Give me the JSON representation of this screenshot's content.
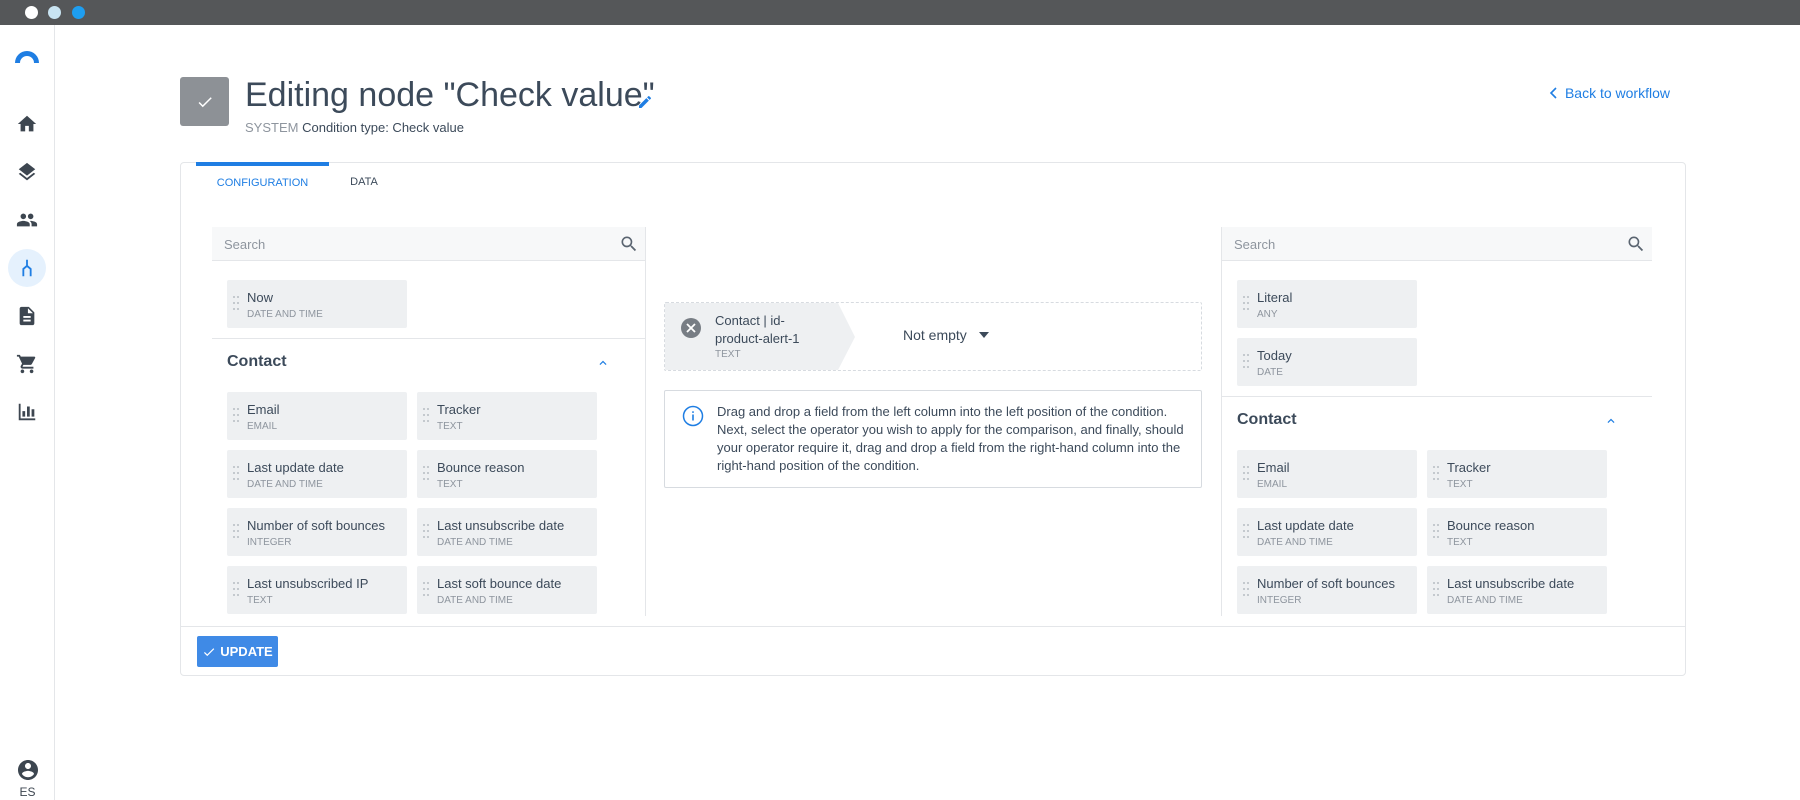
{
  "window": {
    "controls": [
      "close",
      "minimize",
      "maximize"
    ]
  },
  "sidebar": {
    "logo": "arc-logo-icon",
    "items": [
      {
        "icon": "home-icon",
        "active": false
      },
      {
        "icon": "layers-icon",
        "active": false
      },
      {
        "icon": "people-icon",
        "active": false
      },
      {
        "icon": "workflow-icon",
        "active": true
      },
      {
        "icon": "document-icon",
        "active": false
      },
      {
        "icon": "cart-icon",
        "active": false
      },
      {
        "icon": "bar-chart-icon",
        "active": false
      }
    ],
    "user_lang": "ES"
  },
  "header": {
    "title": "Editing node \"Check value\"",
    "system_label": "SYSTEM",
    "condition_type": "Condition type: Check value",
    "back_link": "Back to workflow"
  },
  "tabs": [
    {
      "label": "CONFIGURATION",
      "active": true
    },
    {
      "label": "DATA",
      "active": false
    }
  ],
  "left_panel": {
    "search_placeholder": "Search",
    "top_fields": [
      {
        "name": "Now",
        "type": "DATE AND TIME"
      }
    ],
    "group_title": "Contact",
    "fields": [
      {
        "name": "Email",
        "type": "EMAIL"
      },
      {
        "name": "Tracker",
        "type": "TEXT"
      },
      {
        "name": "Last update date",
        "type": "DATE AND TIME"
      },
      {
        "name": "Bounce reason",
        "type": "TEXT"
      },
      {
        "name": "Number of soft bounces",
        "type": "INTEGER"
      },
      {
        "name": "Last unsubscribe date",
        "type": "DATE AND TIME"
      },
      {
        "name": "Last unsubscribed IP",
        "type": "TEXT"
      },
      {
        "name": "Last soft bounce date",
        "type": "DATE AND TIME"
      }
    ]
  },
  "condition": {
    "left_field": "Contact | id-product-alert-1",
    "left_type": "TEXT",
    "operator": "Not empty",
    "info_text": "Drag and drop a field from the left column into the left position of the condition. Next, select the operator you wish to apply for the comparison, and finally, should your operator require it, drag and drop a field from the right-hand column into the right-hand position of the condition."
  },
  "right_panel": {
    "search_placeholder": "Search",
    "top_fields": [
      {
        "name": "Literal",
        "type": "ANY"
      },
      {
        "name": "Today",
        "type": "DATE"
      }
    ],
    "group_title": "Contact",
    "fields": [
      {
        "name": "Email",
        "type": "EMAIL"
      },
      {
        "name": "Tracker",
        "type": "TEXT"
      },
      {
        "name": "Last update date",
        "type": "DATE AND TIME"
      },
      {
        "name": "Bounce reason",
        "type": "TEXT"
      },
      {
        "name": "Number of soft bounces",
        "type": "INTEGER"
      },
      {
        "name": "Last unsubscribe date",
        "type": "DATE AND TIME"
      }
    ]
  },
  "footer": {
    "update_label": "UPDATE"
  },
  "colors": {
    "accent": "#1f7ee3",
    "button": "#3f8ae6",
    "field_bg": "#eef0f2"
  }
}
